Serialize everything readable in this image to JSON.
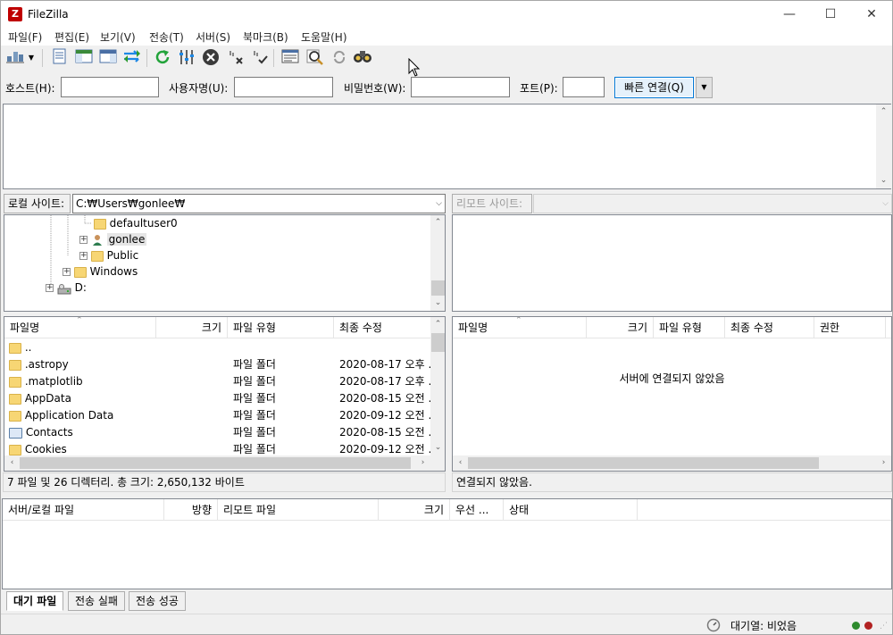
{
  "window": {
    "title": "FileZilla",
    "icon_text": "Z",
    "min_glyph": "—",
    "max_glyph": "☐",
    "close_glyph": "✕"
  },
  "menu": [
    "파일(F)",
    "편집(E)",
    "보기(V)",
    "전송(T)",
    "서버(S)",
    "북마크(B)",
    "도움말(H)"
  ],
  "toolbar": {
    "icons": [
      "site-manager-icon",
      "dropdown-arrow-icon",
      "message-log-toggle-icon",
      "local-tree-toggle-icon",
      "remote-tree-toggle-icon",
      "queue-toggle-icon",
      "refresh-icon",
      "process-queue-icon",
      "cancel-icon",
      "disconnect-icon",
      "reconnect-icon",
      "directory-filter-icon",
      "compare-icon",
      "sync-browse-icon",
      "search-icon"
    ]
  },
  "quickconnect": {
    "host_label": "호스트(H):",
    "user_label": "사용자명(U):",
    "pass_label": "비밀번호(W):",
    "port_label": "포트(P):",
    "host_value": "",
    "user_value": "",
    "pass_value": "",
    "port_value": "",
    "connect_label": "빠른 연결(Q)",
    "dropdown_glyph": "▼"
  },
  "local": {
    "path_label": "로컬 사이트:",
    "path": "C:₩Users₩gonlee₩",
    "tree": [
      {
        "label": "defaultuser0",
        "indent": 2,
        "expander": false,
        "icon": "folder"
      },
      {
        "label": "gonlee",
        "indent": 2,
        "expander": true,
        "icon": "user"
      },
      {
        "label": "Public",
        "indent": 2,
        "expander": true,
        "icon": "folder"
      },
      {
        "label": "Windows",
        "indent": 1,
        "expander": true,
        "icon": "folder"
      },
      {
        "label": "D:",
        "indent": 0,
        "expander": true,
        "icon": "drive"
      }
    ],
    "columns": [
      "파일명",
      "크기",
      "파일 유형",
      "최종 수정"
    ],
    "files": [
      {
        "name": "..",
        "size": "",
        "type": "",
        "modified": "",
        "icon": "folder"
      },
      {
        "name": ".astropy",
        "size": "",
        "type": "파일 폴더",
        "modified": "2020-08-17 오후 .",
        "icon": "folder"
      },
      {
        "name": ".matplotlib",
        "size": "",
        "type": "파일 폴더",
        "modified": "2020-08-17 오후 .",
        "icon": "folder"
      },
      {
        "name": "AppData",
        "size": "",
        "type": "파일 폴더",
        "modified": "2020-08-15 오전 .",
        "icon": "folder"
      },
      {
        "name": "Application Data",
        "size": "",
        "type": "파일 폴더",
        "modified": "2020-09-12 오전 .",
        "icon": "folder"
      },
      {
        "name": "Contacts",
        "size": "",
        "type": "파일 폴더",
        "modified": "2020-08-15 오전 .",
        "icon": "contacts"
      },
      {
        "name": "Cookies",
        "size": "",
        "type": "파일 폴더",
        "modified": "2020-09-12 오전 .",
        "icon": "folder"
      }
    ],
    "status": "7 파일 및 26 디렉터리. 총 크기: 2,650,132 바이트"
  },
  "remote": {
    "path_label": "리모트 사이트:",
    "path": "",
    "columns": [
      "파일명",
      "크기",
      "파일 유형",
      "최종 수정",
      "권한"
    ],
    "empty_message": "서버에 연결되지 않았음",
    "status": "연결되지 않았음."
  },
  "queue": {
    "columns": [
      "서버/로컬 파일",
      "방향",
      "리모트 파일",
      "크기",
      "우선 ...",
      "상태"
    ],
    "tabs": [
      "대기 파일",
      "전송 실패",
      "전송 성공"
    ],
    "status": "대기열: 비었음"
  },
  "colors": {
    "accent": "#0078d7",
    "folder": "#f7d674",
    "led_green": "#2e8b2e",
    "led_red": "#b22222"
  }
}
